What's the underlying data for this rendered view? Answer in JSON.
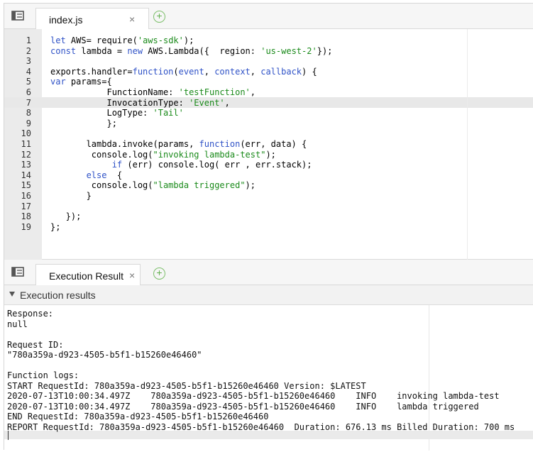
{
  "editor_tab": {
    "label": "index.js",
    "close": "×"
  },
  "result_tab": {
    "label": "Execution Result",
    "close": "×"
  },
  "add_symbol": "+",
  "results_section": {
    "title": "Execution results"
  },
  "code_lines": [
    "let AWS= require('aws-sdk');",
    "const lambda = new AWS.Lambda({  region: 'us-west-2'});",
    "",
    "exports.handler=function(event, context, callback) {",
    "var params={",
    "           FunctionName: 'testFunction',",
    "           InvocationType: 'Event',",
    "           LogType: 'Tail'",
    "           };",
    "",
    "       lambda.invoke(params, function(err, data) {",
    "        console.log(\"invoking lambda-test\");",
    "            if (err) console.log( err , err.stack);",
    "       else  {",
    "        console.log(\"lambda triggered\");",
    "       }",
    "",
    "   });",
    "};"
  ],
  "output_lines": [
    "Response:",
    "null",
    "",
    "Request ID:",
    "\"780a359a-d923-4505-b5f1-b15260e46460\"",
    "",
    "Function logs:",
    "START RequestId: 780a359a-d923-4505-b5f1-b15260e46460 Version: $LATEST",
    "2020-07-13T10:00:34.497Z    780a359a-d923-4505-b5f1-b15260e46460    INFO    invoking lambda-test",
    "2020-07-13T10:00:34.497Z    780a359a-d923-4505-b5f1-b15260e46460    INFO    lambda triggered",
    "END RequestId: 780a359a-d923-4505-b5f1-b15260e46460",
    "REPORT RequestId: 780a359a-d923-4505-b5f1-b15260e46460  Duration: 676.13 ms Billed Duration: 700 ms"
  ],
  "colors": {
    "keyword": "#2f52c7",
    "string": "#1a8a1a",
    "add_icon": "#5faf4b"
  },
  "icons": {
    "menu": "menu-icon",
    "add": "add-tab-icon",
    "close": "close-icon",
    "caret": "caret-down-icon"
  }
}
